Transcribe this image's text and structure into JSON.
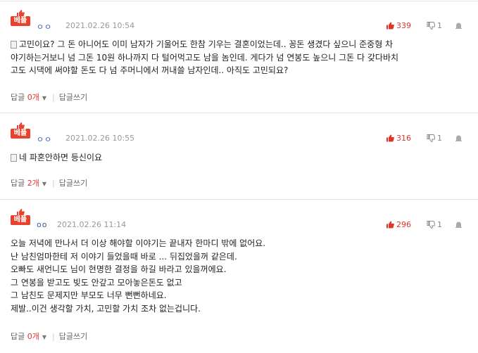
{
  "comments": [
    {
      "badge": "베플",
      "author": "ㅇㅇ",
      "date": "2021.02.26 10:54",
      "likes": "339",
      "dislikes": "1",
      "lines": [
        "고민이요? 그 돈 아니어도 이미 남자가 기울어도 한참 기우는 결혼이었는데.. 꽁돈 생겼다 싶으니 준중형 차",
        "야기하는거보니 넘 그돈 10원 하나까지 다 털어먹고도 남을 놈인데. 게다가 넘 연봉도 높으니 그돈 다 갖다바치",
        "고도 시댁에 써야할 돈도 다 넘 주머니에서 꺼내쓸 남자인데.. 아직도 고민되요?"
      ],
      "reply_label": "답글",
      "reply_count": "0개",
      "write_label": "답글쓰기"
    },
    {
      "badge": "베플",
      "author": "ㅇㅇ",
      "date": "2021.02.26 10:55",
      "likes": "316",
      "dislikes": "1",
      "lines": [
        "네 파혼안하면 등신이요"
      ],
      "reply_label": "답글",
      "reply_count": "2개",
      "write_label": "답글쓰기"
    },
    {
      "badge": "베플",
      "author": "oo",
      "date": "2021.02.26 11:14",
      "likes": "296",
      "dislikes": "1",
      "lines": [
        "오늘 저녁에 만나서 더 이상 해야할 이야기는 끝내자 한마디 밖에 없어요.",
        "난 남친엄마한테 저 이야기 들었을때 바로 ... 뒤집었을꺼 같은데.",
        "오빠도 새언니도 님이 현명한 결정을 하길 바라고 있을꺼에요.",
        "그 연봉을 받고도 빚도 안갚고 모아놓은돈도 없고",
        "그 남친도 문제지만 부모도 너무 뻔뻔하네요.",
        "제발..이건 생각할 가치, 고민할 가치 조차 없는겁니다."
      ],
      "reply_label": "답글",
      "reply_count": "0개",
      "write_label": "답글쓰기"
    }
  ],
  "colors": {
    "accent": "#e0352b",
    "badge_bg": "#e8412c",
    "author": "#3a5ab0"
  },
  "icons": [
    "thumb-up-icon",
    "thumb-down-icon",
    "report-icon",
    "document-icon",
    "caret-down-icon"
  ]
}
